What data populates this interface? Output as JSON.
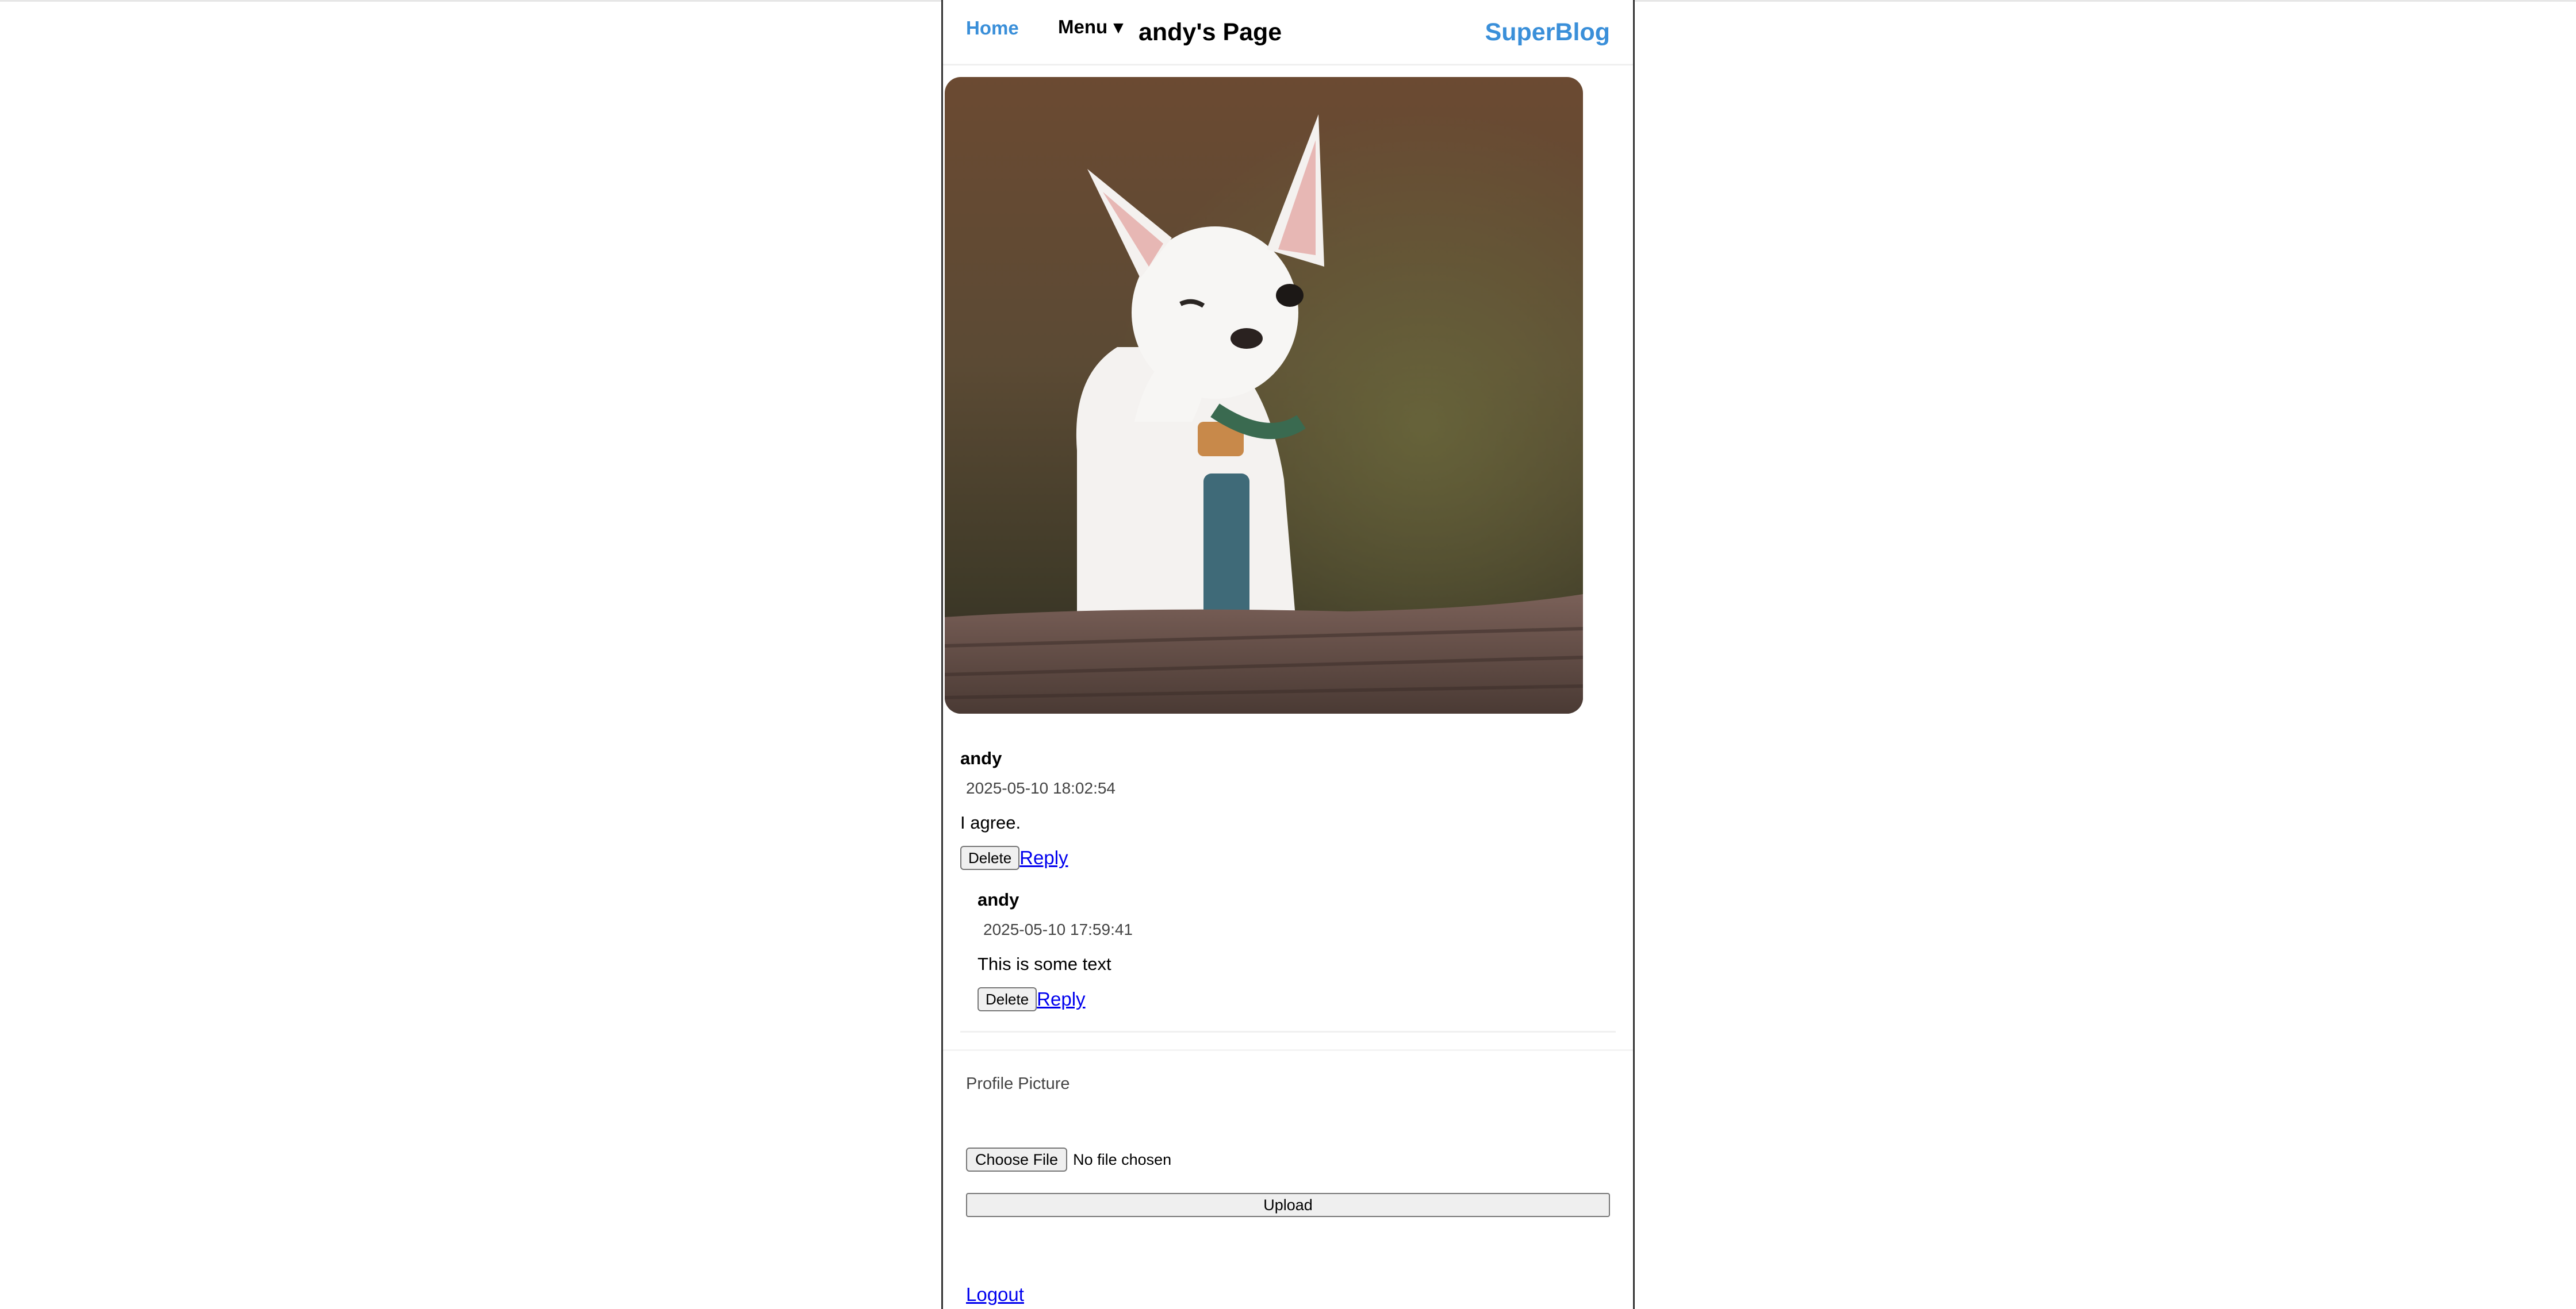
{
  "nav": {
    "home_label": "Home",
    "menu_label": "Menu",
    "menu_caret": "▼",
    "page_title": "andy's Page",
    "brand": "SuperBlog"
  },
  "post": {
    "image_alt_icon": "photo-chihuahua-icon"
  },
  "comments": [
    {
      "author": "andy",
      "timestamp": "2025-05-10 18:02:54",
      "body": "I agree.",
      "delete_label": "Delete",
      "reply_label": "Reply"
    },
    {
      "author": "andy",
      "timestamp": "2025-05-10 17:59:41",
      "body": "This is some text",
      "delete_label": "Delete",
      "reply_label": "Reply"
    }
  ],
  "profile": {
    "label": "Profile Picture",
    "choose_file_label": "Choose File",
    "file_status": "No file chosen",
    "upload_label": "Upload"
  },
  "logout_label": "Logout",
  "colors": {
    "accent": "#3a8fd9",
    "link": "#0000ee"
  }
}
